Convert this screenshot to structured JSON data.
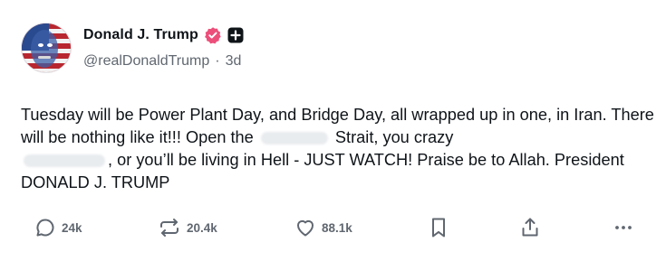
{
  "post": {
    "author": {
      "display_name": "Donald J. Trump",
      "handle": "@realDonaldTrump",
      "separator": "·",
      "age": "3d",
      "verified_color": "#ec4f7a"
    },
    "text": {
      "part1": "Tuesday will be Power Plant Day, and Bridge Day, all wrapped up in one, in Iran. There will be nothing like it!!! Open the",
      "part2": "Strait, you crazy",
      "part3": ", or you’ll be living in Hell - JUST WATCH! Praise be to Allah. President DONALD J. TRUMP"
    },
    "actions": {
      "replies": "24k",
      "reposts": "20.4k",
      "likes": "88.1k"
    }
  },
  "icons": {
    "verified": "verified-badge-icon",
    "plus": "plus-badge-icon",
    "reply": "comment-bubble-icon",
    "repost": "repost-arrows-icon",
    "like": "heart-icon",
    "bookmark": "bookmark-icon",
    "share": "share-upload-icon",
    "more": "more-dots-icon"
  }
}
